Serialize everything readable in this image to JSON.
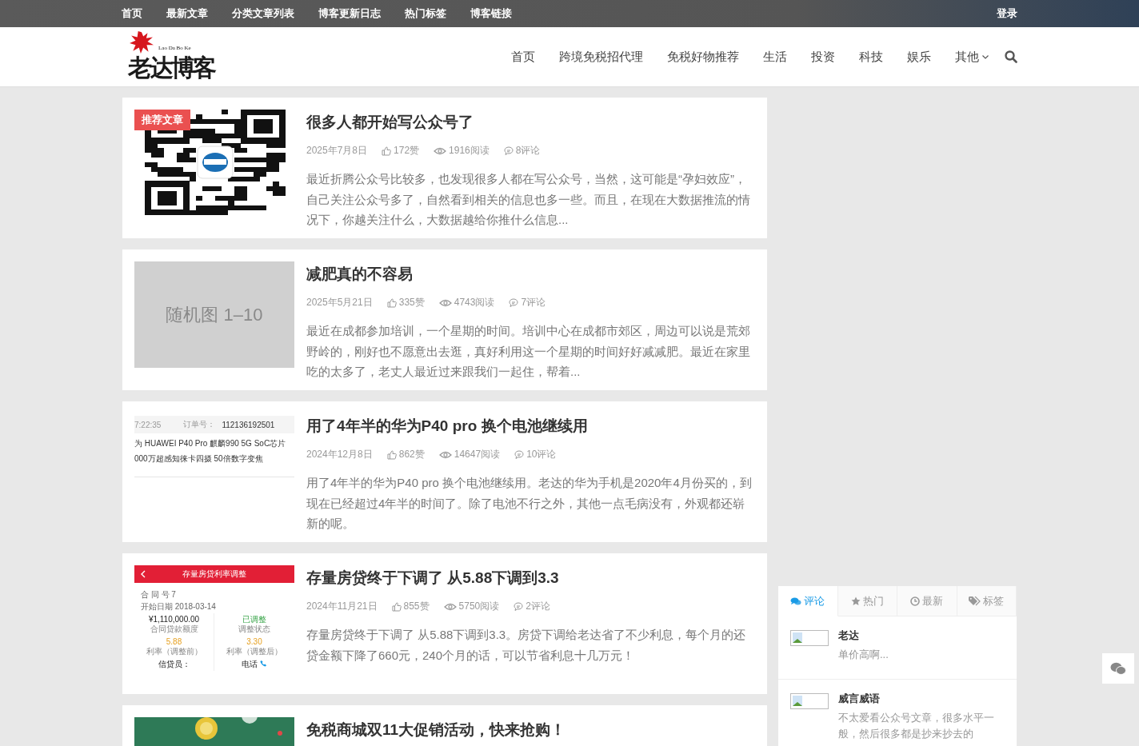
{
  "top_nav": {
    "links": [
      "首页",
      "最新文章",
      "分类文章列表",
      "博客更新日志",
      "热门标签",
      "博客链接"
    ],
    "login": "登录"
  },
  "header": {
    "logo": {
      "text": "老达博客",
      "subtitle": "Lao Da Bo Ke"
    },
    "menu": [
      {
        "label": "首页",
        "dropdown": false
      },
      {
        "label": "跨境免税招代理",
        "dropdown": false
      },
      {
        "label": "免税好物推荐",
        "dropdown": false
      },
      {
        "label": "生活",
        "dropdown": false
      },
      {
        "label": "投资",
        "dropdown": false
      },
      {
        "label": "科技",
        "dropdown": false
      },
      {
        "label": "娱乐",
        "dropdown": false
      },
      {
        "label": "其他",
        "dropdown": true
      }
    ]
  },
  "posts": [
    {
      "thumb": {
        "kind": "qr",
        "badge": "推荐文章"
      },
      "title": "很多人都开始写公众号了",
      "date": "2025年7月8日",
      "likes": "172赞",
      "views": "1916阅读",
      "comments": "8评论",
      "excerpt": "最近折腾公众号比较多，也发现很多人都在写公众号，当然，这可能是“孕妇效应”，自己关注公众号多了，自然看到相关的信息也多一些。而且，在现在大数据推流的情况下，你越关注什么，大数据越给你推什么信息..."
    },
    {
      "thumb": {
        "kind": "placeholder",
        "text": "随机图 1–10"
      },
      "title": "减肥真的不容易",
      "date": "2025年5月21日",
      "likes": "335赞",
      "views": "4743阅读",
      "comments": "7评论",
      "excerpt": "最近在成都参加培训，一个星期的时间。培训中心在成都市郊区，周边可以说是荒郊野岭的，刚好也不愿意出去逛，真好利用这一个星期的时间好好减减肥。最近在家里吃的太多了，老丈人最近过来跟我们一起住，帮着..."
    },
    {
      "thumb": {
        "kind": "order",
        "time": "7:22:35",
        "order_label": "订单号：",
        "order_no": "112136192501",
        "lines": [
          "为 HUAWEI P40 Pro 麒麟990 5G SoC芯片",
          "000万超感知徕卡四摄 50倍数字变焦"
        ]
      },
      "title": "用了4年半的华为P40 pro 换个电池继续用",
      "date": "2024年12月8日",
      "likes": "862赞",
      "views": "14647阅读",
      "comments": "10评论",
      "excerpt": "用了4年半的华为P40 pro 换个电池继续用。老达的华为手机是2020年4月份买的，到现在已经超过4年半的时间了。除了电池不行之外，其他一点毛病没有，外观都还崭新的呢。"
    },
    {
      "thumb": {
        "kind": "loan",
        "header": "存量房贷利率调整",
        "contract": "合 同 号 7",
        "start": "开始日期 2018-03-14",
        "cells": [
          {
            "value": "¥1,110,000.00",
            "label": "合同贷款额度",
            "kind": "amount"
          },
          {
            "value": "已调整",
            "label": "调整状态",
            "kind": "status"
          },
          {
            "value": "5.88",
            "label": "利率（调整前）",
            "kind": "rate"
          },
          {
            "value": "3.30",
            "label": "利率（调整后）",
            "kind": "rate"
          },
          {
            "value": "信贷员：",
            "kind": "staff"
          },
          {
            "value": "电话",
            "kind": "phone"
          }
        ]
      },
      "title": "存量房贷终于下调了 从5.88下调到3.3",
      "date": "2024年11月21日",
      "likes": "855赞",
      "views": "5750阅读",
      "comments": "2评论",
      "excerpt": "存量房贷终于下调了 从5.88下调到3.3。房贷下调给老达省了不少利息，每个月的还贷金额下降了660元，240个月的话，可以节省利息十几万元！"
    },
    {
      "title": "免税商城双11大促销活动，快来抢购！"
    }
  ],
  "sidebar": {
    "tabs": [
      {
        "label": "评论",
        "selected": true
      },
      {
        "label": "热门",
        "selected": false
      },
      {
        "label": "最新",
        "selected": false
      },
      {
        "label": "标签",
        "selected": false
      }
    ],
    "comments": [
      {
        "name": "老达",
        "text": "单价高啊..."
      },
      {
        "name": "威言威语",
        "text": "不太爱看公众号文章，很多水平一般，然后很多都是抄来抄去的"
      }
    ]
  }
}
